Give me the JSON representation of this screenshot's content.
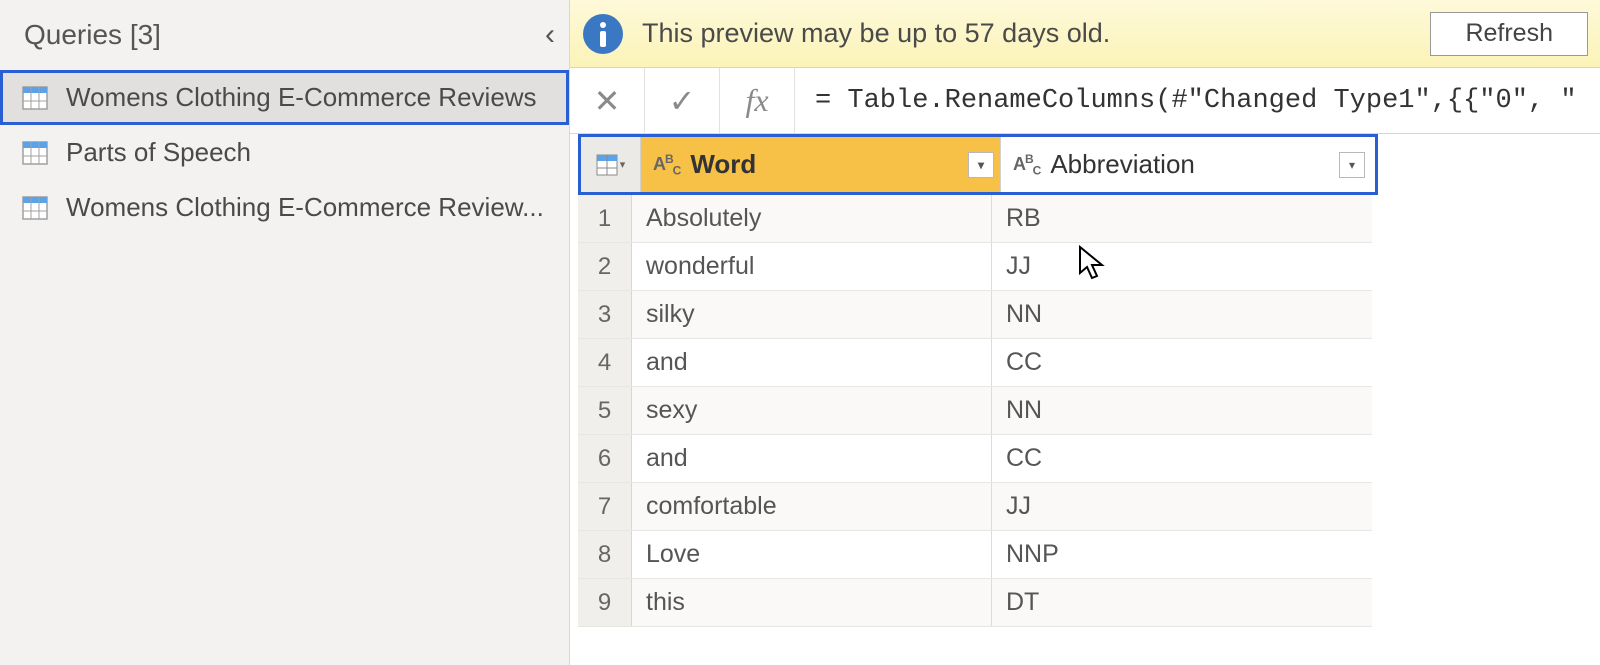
{
  "queries_pane": {
    "title": "Queries [3]",
    "items": [
      {
        "label": "Womens Clothing E-Commerce Reviews",
        "selected": true
      },
      {
        "label": "Parts of Speech",
        "selected": false
      },
      {
        "label": "Womens Clothing E-Commerce Review...",
        "selected": false
      }
    ]
  },
  "notification": {
    "text": "This preview may be up to 57 days old.",
    "refresh_label": "Refresh"
  },
  "formula_bar": {
    "cancel_symbol": "✕",
    "accept_symbol": "✓",
    "fx_label": "fx",
    "text": "= Table.RenameColumns(#\"Changed Type1\",{{\"0\", \""
  },
  "grid": {
    "columns": [
      {
        "name": "Word",
        "type_label": "ABC"
      },
      {
        "name": "Abbreviation",
        "type_label": "ABC"
      }
    ],
    "rows": [
      {
        "n": "1",
        "word": "Absolutely",
        "abbrev": "RB"
      },
      {
        "n": "2",
        "word": "wonderful",
        "abbrev": "JJ"
      },
      {
        "n": "3",
        "word": "silky",
        "abbrev": "NN"
      },
      {
        "n": "4",
        "word": "and",
        "abbrev": "CC"
      },
      {
        "n": "5",
        "word": "sexy",
        "abbrev": "NN"
      },
      {
        "n": "6",
        "word": "and",
        "abbrev": "CC"
      },
      {
        "n": "7",
        "word": "comfortable",
        "abbrev": "JJ"
      },
      {
        "n": "8",
        "word": "Love",
        "abbrev": "NNP"
      },
      {
        "n": "9",
        "word": "this",
        "abbrev": "DT"
      }
    ]
  }
}
